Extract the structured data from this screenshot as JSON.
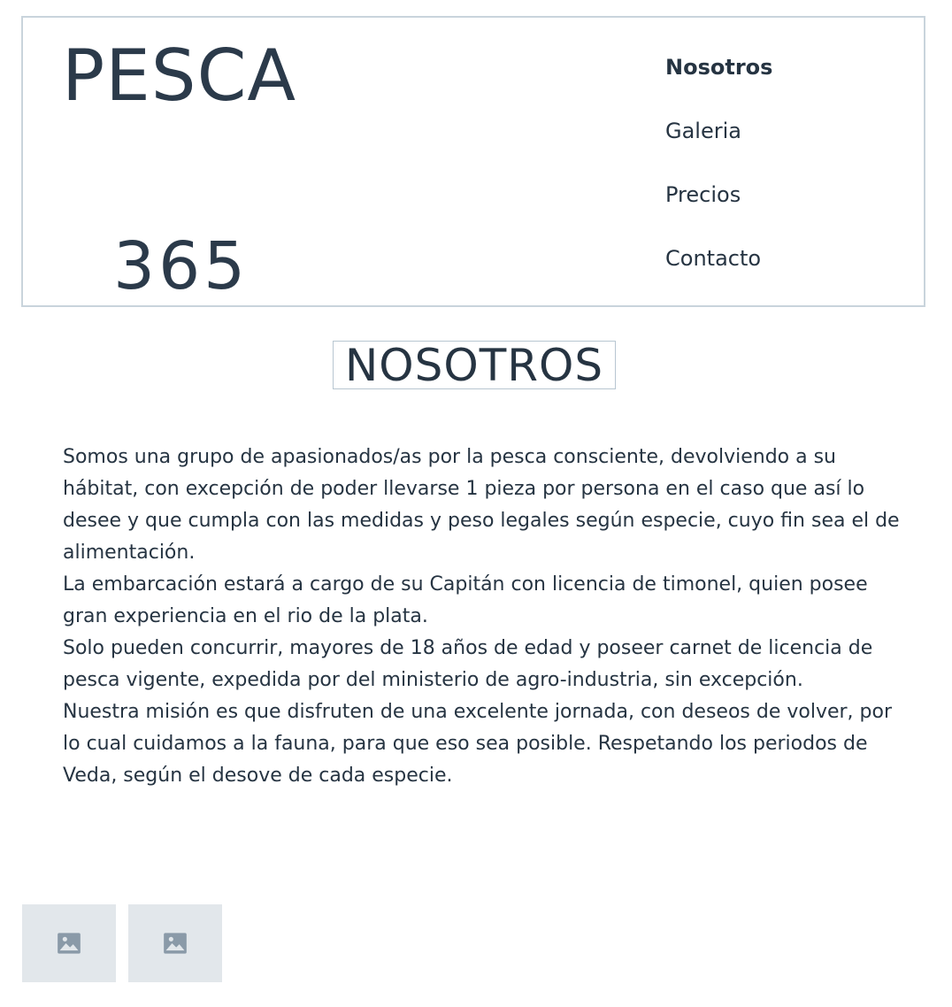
{
  "header": {
    "logo_top": "PESCA",
    "logo_bottom": "365",
    "nav": [
      {
        "label": "Nosotros",
        "active": true
      },
      {
        "label": "Galeria",
        "active": false
      },
      {
        "label": "Precios",
        "active": false
      },
      {
        "label": "Contacto",
        "active": false
      }
    ]
  },
  "main": {
    "title": "NOSOTROS",
    "paragraphs": [
      "Somos una grupo de apasionados/as por la pesca consciente, devolviendo a su hábitat, con excepción de poder llevarse 1 pieza por persona en el caso que así lo desee y que cumpla con las medidas y peso legales según especie, cuyo fin sea el de alimentación.",
      "La embarcación estará a cargo de su Capitán con licencia de timonel, quien posee gran experiencia en el rio de la plata.",
      "Solo pueden concurrir, mayores de 18 años de edad y poseer carnet de licencia de pesca vigente, expedida por del ministerio de agro-industria, sin excepción.",
      "Nuestra misión es que disfruten de una excelente jornada, con deseos de volver, por lo cual cuidamos a la fauna, para que eso sea posible. Respetando los periodos de Veda, según el desove de cada especie."
    ]
  },
  "gallery": {
    "thumbnails": [
      {
        "icon": "image-placeholder-icon"
      },
      {
        "icon": "image-placeholder-icon"
      }
    ]
  },
  "colors": {
    "text": "#263442",
    "border": "#c9d4dc",
    "thumb_bg": "#e2e7eb",
    "icon": "#8a9aa8"
  }
}
